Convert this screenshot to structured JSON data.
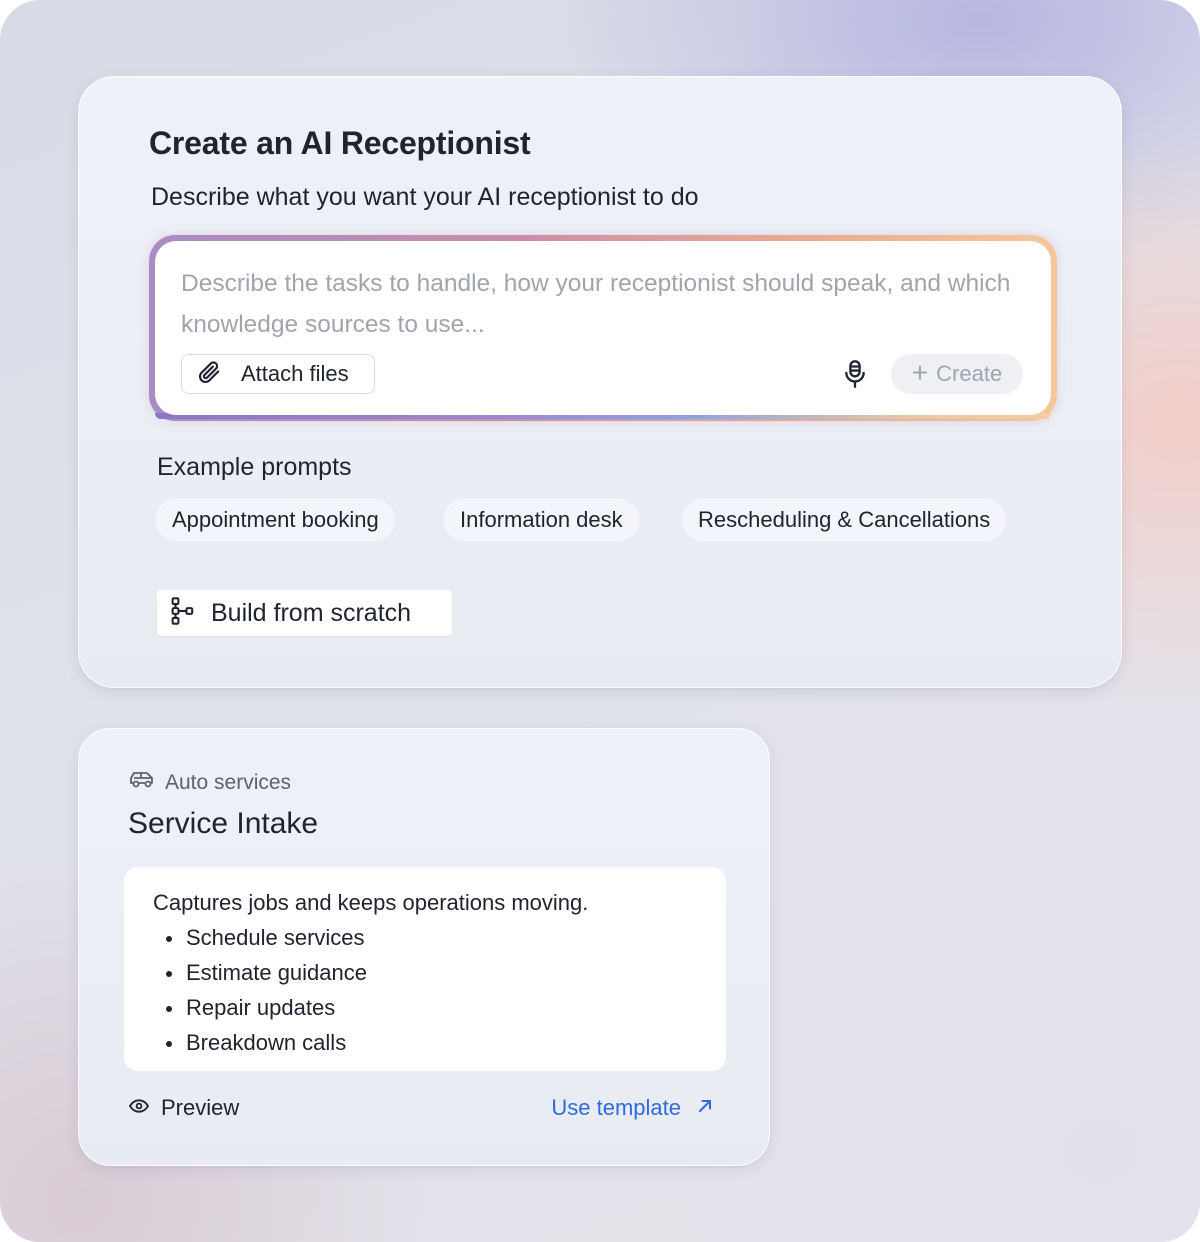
{
  "main": {
    "title": "Create an AI Receptionist",
    "subtitle": "Describe what you want your AI receptionist to do",
    "prompt": {
      "placeholder": "Describe the tasks to handle, how your receptionist should speak, and which knowledge sources to use...",
      "attach_label": "Attach files",
      "create_label": "Create",
      "mic_icon": "microphone-icon",
      "attach_icon": "paperclip-icon"
    },
    "examples_label": "Example prompts",
    "examples": [
      "Appointment booking",
      "Information desk",
      "Rescheduling & Cancellations"
    ],
    "scratch_label": "Build from scratch",
    "scratch_icon": "flow-diagram-icon"
  },
  "template": {
    "category": "Auto services",
    "category_icon": "car-icon",
    "title": "Service Intake",
    "description": "Captures jobs and keeps operations moving.",
    "items": [
      "Schedule services",
      "Estimate guidance",
      "Repair updates",
      "Breakdown calls"
    ],
    "preview_label": "Preview",
    "use_label": "Use template",
    "link_color": "#2f6be0"
  }
}
